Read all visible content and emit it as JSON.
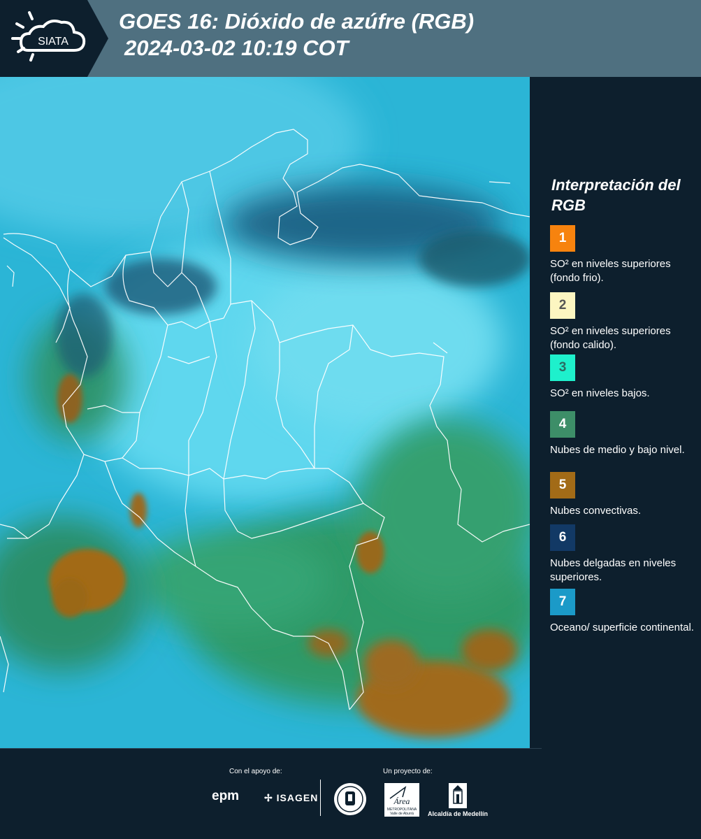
{
  "header": {
    "logo_text": "SIATA",
    "title_line1": "GOES 16: Dióxido de azúfre (RGB)",
    "title_line2": "2024-03-02 10:19 COT"
  },
  "legend": {
    "title": "Interpretación del RGB",
    "items": [
      {
        "number": "1",
        "label": "SO² en niveles superiores (fondo frio).",
        "color": "#f7830e"
      },
      {
        "number": "2",
        "label": "SO² en niveles superiores (fondo calido).",
        "color": "#fcf6c1"
      },
      {
        "number": "3",
        "label": "SO² en niveles bajos.",
        "color": "#1ef0cc"
      },
      {
        "number": "4",
        "label": "Nubes de medio y bajo nivel.",
        "color": "#3d8e68"
      },
      {
        "number": "5",
        "label": "Nubes convectivas.",
        "color": "#a26b17"
      },
      {
        "number": "6",
        "label": "Nubes delgadas en niveles superiores.",
        "color": "#123965"
      },
      {
        "number": "7",
        "label": "Oceano/ superficie continental.",
        "color": "#1b9ac8"
      }
    ]
  },
  "footer": {
    "support_label": "Con el apoyo de:",
    "project_label": "Un proyecto de:",
    "brand_epm": "epm",
    "brand_isagen": "ISAGEN",
    "area_line1": "Área",
    "area_line2": "METROPOLITANA",
    "area_line3": "Valle de Aburrá",
    "alcaldia_label": "Alcaldía de Medellín"
  },
  "colors": {
    "header_bg": "#4f7080",
    "panel_bg": "#0d1f2d",
    "ocean_cyan": "#29b6d8",
    "vegetation_green": "#2f9a68",
    "convective_brown": "#a26b17"
  }
}
